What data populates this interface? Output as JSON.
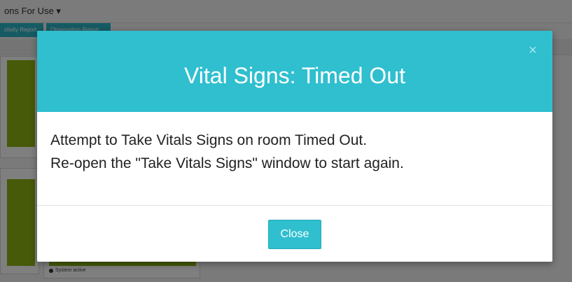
{
  "background": {
    "menu_label": "ons For Use ▾",
    "tabs": [
      {
        "label": "ctivity Report"
      },
      {
        "label": "Observation Report"
      }
    ],
    "room_label": "ma_r1",
    "status_text": "System active"
  },
  "modal": {
    "title": "Vital Signs: Timed Out",
    "close_icon": "×",
    "body_lines": [
      "Attempt to Take Vitals Signs on room Timed Out.",
      "Re-open the \"Take Vitals Signs\" window to start again."
    ],
    "close_button_label": "Close"
  },
  "colors": {
    "accent": "#2fbfcf",
    "status_green": "#8cb514"
  }
}
